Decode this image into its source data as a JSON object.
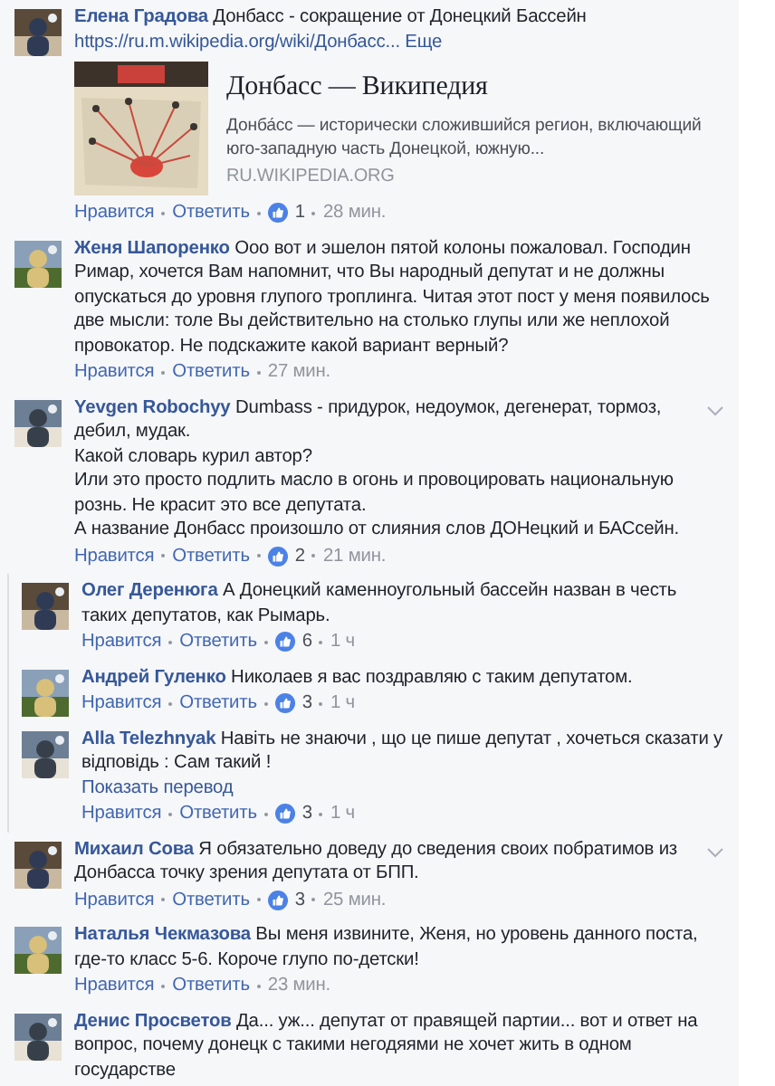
{
  "comments": [
    {
      "kind": "top",
      "name": "Елена Градова",
      "text": "Донбасс - сокращение от Донецкий Бассейн",
      "link": "https://ru.m.wikipedia.org/wiki/Донбасс...",
      "more": "Еще",
      "preview": {
        "title": "Донбасс — Википедия",
        "description": "Донба́сс — исторически сложившийся регион, включающий юго-западную часть Донецкой, южную...",
        "domain": "RU.WIKIPEDIA.ORG"
      },
      "like": "Нравится",
      "reply": "Ответить",
      "likes": "1",
      "time": "28 мин.",
      "menu": false
    },
    {
      "kind": "top",
      "name": "Женя Шапоренко",
      "text": "Ооо вот и эшелон пятой колоны пожаловал. Господин Римар, хочется Вам напомнит, что Вы народный депутат и не должны опускаться до уровня глупого троплинга. Читая этот пост у меня появилось две мысли: толе Вы действительно на столько глупы или же неплохой провокатор. Не подскажите какой вариант верный?",
      "like": "Нравится",
      "reply": "Ответить",
      "time": "27 мин.",
      "menu": false
    },
    {
      "kind": "top",
      "name": "Yevgen Robochyy",
      "text": "Dumbass - придурок, недоумок, дегенерат, тормоз, дебил, мудак.\nКакой словарь курил автор?\nИли это просто подлить масло в огонь и провоцировать национальную рознь. Не красит это все депутата.\nА название Донбасс произошло от слияния слов ДОНецкий и БАСсейн.",
      "like": "Нравится",
      "reply": "Ответить",
      "likes": "2",
      "time": "21 мин.",
      "menu": true
    },
    {
      "kind": "reply",
      "name": "Олег Деренюга",
      "text": "А Донецкий каменноугольный бассейн назван в честь таких депутатов, как Рымарь.",
      "like": "Нравится",
      "reply": "Ответить",
      "likes": "6",
      "time": "1 ч",
      "menu": false
    },
    {
      "kind": "reply",
      "name": "Андрей Гуленко",
      "text": "Николаев я вас поздравляю с таким депутатом.",
      "like": "Нравится",
      "reply": "Ответить",
      "likes": "3",
      "time": "1 ч",
      "menu": false
    },
    {
      "kind": "reply",
      "name": "Alla Telezhnyak",
      "text": "Навіть не знаючи , що це пише депутат , хочеться сказати у відповідь : Сам такий !",
      "translate": "Показать перевод",
      "like": "Нравится",
      "reply": "Ответить",
      "likes": "3",
      "time": "1 ч",
      "menu": false
    },
    {
      "kind": "top",
      "name": "Михаил Сова",
      "text": "Я обязательно доведу до сведения своих побратимов из Донбасса точку зрения депутата от БПП.",
      "like": "Нравится",
      "reply": "Ответить",
      "likes": "3",
      "time": "25 мин.",
      "menu": true
    },
    {
      "kind": "top",
      "name": "Наталья Чекмазова",
      "text": "Вы меня извините, Женя, но уровень данного поста, где-то класс 5-6. Короче глупо по-детски!",
      "like": "Нравится",
      "reply": "Ответить",
      "time": "23 мин.",
      "menu": false
    },
    {
      "kind": "top",
      "name": "Денис Просветов",
      "text": "Да... уж... депутат от правящей партии... вот и ответ на вопрос, почему донецк с такими негодяями не хочет жить в одном государстве",
      "menu": false
    }
  ]
}
